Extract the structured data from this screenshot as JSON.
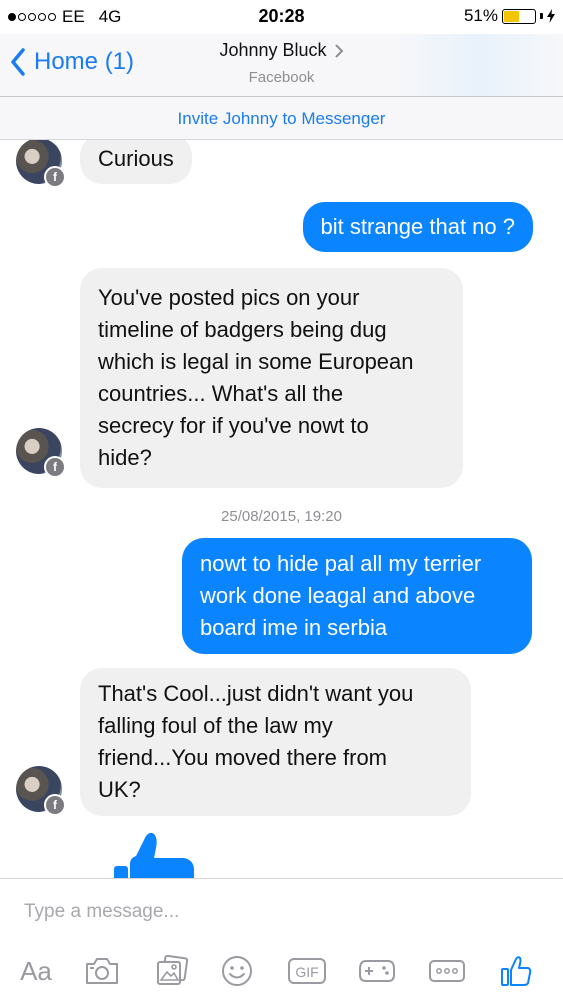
{
  "status": {
    "carrier": "EE",
    "network": "4G",
    "time": "20:28",
    "battery": "51%",
    "battery_level": 0.51
  },
  "nav": {
    "back_label": "Home (1)",
    "contact_name": "Johnny Bluck",
    "contact_source": "Facebook"
  },
  "invite": {
    "label": "Invite Johnny to Messenger"
  },
  "messages": [
    {
      "dir": "in",
      "text": "Curious"
    },
    {
      "dir": "out",
      "text": "bit strange that no ?"
    },
    {
      "dir": "in",
      "lines": [
        "You've posted pics on your",
        "timeline of badgers being dug",
        "which is legal in some European",
        "countries... What's all the",
        "secrecy for if you've nowt to",
        "hide?"
      ]
    },
    {
      "dir": "out",
      "lines": [
        "nowt to hide pal all my terrier",
        "work done leagal and above",
        "board ime in serbia"
      ]
    },
    {
      "dir": "in",
      "lines": [
        "That's Cool...just didn't want you",
        "falling foul of the law  my",
        "friend...You moved there from",
        "UK?"
      ]
    }
  ],
  "timestamp": "25/08/2015, 19:20",
  "composer": {
    "placeholder": "Type a message...",
    "text_tool": "Aa",
    "gif_tool": "GIF",
    "icons": [
      "camera-icon",
      "photo-icon",
      "emoji-icon",
      "gif-icon",
      "game-icon",
      "more-icon",
      "thumbs-up-icon"
    ]
  },
  "colors": {
    "accent": "#0a84ff",
    "incoming": "#f1f0f0",
    "link": "#1a7cf0",
    "battery": "#f5c400"
  }
}
